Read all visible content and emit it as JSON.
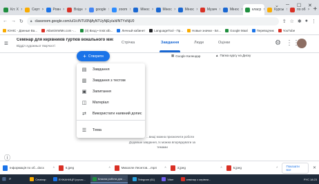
{
  "browser": {
    "tabs": [
      {
        "label": "Кл: Х",
        "color": "#1e8e3e",
        "active": false
      },
      {
        "label": "Серт",
        "color": "#f9ab00",
        "active": false
      },
      {
        "label": "Ровн",
        "color": "#1a73e8",
        "active": false
      },
      {
        "label": "Вхідн",
        "color": "#d93025",
        "active": false
      },
      {
        "label": "google",
        "color": "#4285f4",
        "active": false
      },
      {
        "label": "zoom",
        "color": "#2d8cff",
        "active": false
      },
      {
        "label": "Мінос",
        "color": "#1967d2",
        "active": false
      },
      {
        "label": "Мінос",
        "color": "#1967d2",
        "active": false
      },
      {
        "label": "Мінос",
        "color": "#1967d2",
        "active": false
      },
      {
        "label": "Музич",
        "color": "#d93025",
        "active": false
      },
      {
        "label": "Мінос",
        "color": "#1967d2",
        "active": false
      },
      {
        "label": "класр",
        "color": "#1e8e3e",
        "active": true
      },
      {
        "label": "Курсы",
        "color": "#f9ab00",
        "active": false
      },
      {
        "label": "по об",
        "color": "#d93025",
        "active": false
      }
    ],
    "new_tab": "+",
    "window_controls": [
      "⌄",
      "─",
      "☐",
      "✕"
    ],
    "url": "classroom.google.com/u/1/c/NTU0NjAyNTUyNjEy/a/d/NTYxNjU0",
    "bookmarks": [
      {
        "label": "ЮНІС - Данные Ва...",
        "color": "#f9ab00"
      },
      {
        "label": "AtlantimWMs.com -...",
        "color": "#d93025"
      },
      {
        "label": "(3) Вход • Instr.xtb...",
        "color": "#1e8e3e"
      },
      {
        "label": "Личный кабинет",
        "color": "#1a73e8"
      },
      {
        "label": "LanguageTool - Пр...",
        "color": "#202124"
      },
      {
        "label": "Новые значки - Бл...",
        "color": "#f9ab00"
      },
      {
        "label": "Google Maal",
        "color": "#1e8e3e"
      },
      {
        "label": "Переводчик",
        "color": "#1a73e8"
      },
      {
        "label": "YouTube",
        "color": "#d93025"
      }
    ]
  },
  "classroom": {
    "title": "Семінар для керівників гуртків вокального мист...",
    "subtitle": "Відділ художньої творчості",
    "nav_tabs": [
      "Стрічка",
      "Завдання",
      "Люди",
      "Оцінки"
    ],
    "create_label": "Створити",
    "calendar_link": "Google Календар",
    "drive_link": "Папка курсу на Диску",
    "menu_items": [
      {
        "icon": "assignment-icon",
        "glyph": "▤",
        "label": "Завдання"
      },
      {
        "icon": "quiz-icon",
        "glyph": "▥",
        "label": "Завдання з тестом"
      },
      {
        "icon": "question-icon",
        "glyph": "▣",
        "label": "Запитання"
      },
      {
        "icon": "material-icon",
        "glyph": "◫",
        "label": "Матеріал"
      },
      {
        "icon": "reuse-icon",
        "glyph": "⇄",
        "label": "Використати наявний допис"
      },
      {
        "icon": "topic-icon",
        "glyph": "☰",
        "label": "Тема"
      }
    ],
    "empty_line1": "Додавайте завдання й інші роботи",
    "empty_text_prefix": "...",
    "empty_text": "...вищі можна призначити роботи",
    "empty_line2": "Додавши завдання, їх можна впорядкувати за",
    "empty_line3": "темами"
  },
  "downloads": {
    "items": [
      {
        "label": "Інформація по об...docx",
        "kind": "doc"
      },
      {
        "label": "6.jpeg",
        "kind": "img"
      },
      {
        "label": "Михалле Леонтов....mp4",
        "kind": "img"
      },
      {
        "label": "3.jpeg",
        "kind": "img"
      },
      {
        "label": "5.jpeg",
        "kind": "img"
      }
    ],
    "show_all": "Показати все",
    "close": "✕"
  },
  "taskbar": {
    "items": [
      {
        "label": "Семінар",
        "color": "#f9ab00"
      },
      {
        "label": "ЛУЖАНИЦЯ (сучас...",
        "color": "#1a73e8"
      },
      {
        "label": "Класна робота для ...",
        "color": "#1e8e3e"
      },
      {
        "label": "Telegram (61)",
        "color": "#2aa3e0"
      },
      {
        "label": "Viber",
        "color": "#7360f2"
      },
      {
        "label": "семінар с керівни...",
        "color": "#d93025"
      }
    ],
    "tray": "РУС 18:23"
  }
}
